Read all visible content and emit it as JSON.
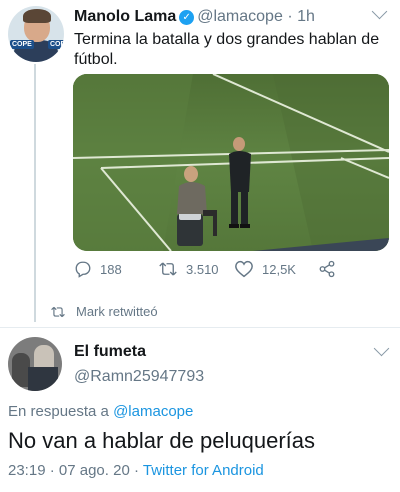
{
  "tweet": {
    "author_name": "Manolo Lama",
    "verified_glyph": "✓",
    "handle": "@lamacope",
    "separator": "·",
    "time": "1h",
    "text": "Termina la batalla y dos grandes hablan de fútbol.",
    "avatar_badge": "COPE",
    "actions": {
      "replies": "188",
      "retweets": "3.510",
      "likes": "12,5K"
    },
    "icons": [
      "reply-icon",
      "retweet-icon",
      "like-icon",
      "share-icon",
      "chevron-down-icon",
      "verified-badge-icon"
    ]
  },
  "retweet_note": "Mark retwitteó",
  "reply": {
    "author_name": "El fumeta",
    "handle": "@Ramn25947793",
    "reply_prefix": "En respuesta a",
    "reply_target": "@lamacope",
    "text": "No van a hablar de peluquerías",
    "time": "23:19",
    "separator": "·",
    "date": "07 ago. 20",
    "separator2": "·",
    "source": "Twitter for Android"
  },
  "colors": {
    "text_primary": "#14171a",
    "text_secondary": "#657786",
    "link": "#1b95e0",
    "verified": "#1da1f2",
    "divider": "#e6ecf0",
    "pitch": "#5a7a3e"
  }
}
